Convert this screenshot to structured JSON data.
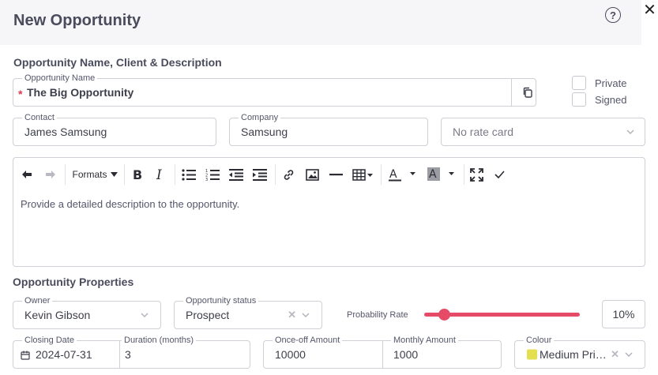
{
  "dialog": {
    "title": "New Opportunity"
  },
  "section_main": {
    "heading": "Opportunity Name, Client & Description"
  },
  "opportunity_name": {
    "label": "Opportunity Name",
    "value": "The Big Opportunity"
  },
  "flags": {
    "private_label": "Private",
    "signed_label": "Signed",
    "private_checked": false,
    "signed_checked": false
  },
  "contact": {
    "label": "Contact",
    "value": "James Samsung"
  },
  "company": {
    "label": "Company",
    "value": "Samsung"
  },
  "rate_card": {
    "placeholder": "No rate card"
  },
  "editor": {
    "formats_label": "Formats",
    "body": "Provide a detailed description to the opportunity."
  },
  "section_props": {
    "heading": "Opportunity Properties"
  },
  "owner": {
    "label": "Owner",
    "value": "Kevin Gibson"
  },
  "status": {
    "label": "Opportunity status",
    "value": "Prospect"
  },
  "probability": {
    "label": "Probability Rate",
    "percent": 10,
    "display": "10%"
  },
  "closing_date": {
    "label": "Closing Date",
    "value": "2024-07-31"
  },
  "duration": {
    "label": "Duration (months)",
    "value": "3"
  },
  "once_off": {
    "label": "Once-off Amount",
    "value": "10000"
  },
  "monthly": {
    "label": "Monthly Amount",
    "value": "1000"
  },
  "colour": {
    "label": "Colour",
    "value": "Medium Prio...",
    "swatch": "#e4df4f"
  },
  "theme": {
    "accent": "#e54a66",
    "border": "#cfd0d6",
    "header_bg": "#f6f6f8"
  }
}
